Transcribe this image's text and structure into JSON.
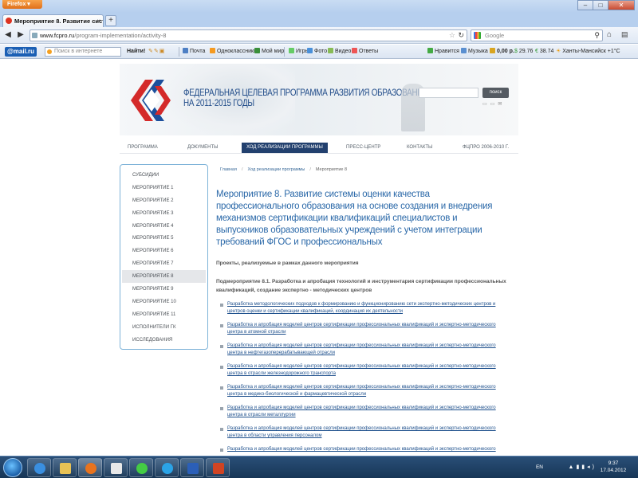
{
  "browser": {
    "app_button": "Firefox",
    "tab_title": "Мероприятие 8. Развитие системы оц...",
    "url_host": "www.fcpro.ru",
    "url_path": "/program-implementation/activity-8",
    "search_placeholder": "Google"
  },
  "mailru_toolbar": {
    "logo": "@mail.ru",
    "search_placeholder": "Поиск в интернете",
    "find_button": "Найти!",
    "items": [
      "Почта",
      "Одноклассники",
      "Мой мир",
      "Игры",
      "Фото",
      "Видео",
      "Ответы"
    ],
    "right_items": [
      "Нравится",
      "Музыка",
      "0,00 р.",
      "29.76",
      "38.74",
      "Ханты-Мансийск +1°C"
    ]
  },
  "site": {
    "header_title_line1": "ФЕДЕРАЛЬНАЯ ЦЕЛЕВАЯ ПРОГРАММА РАЗВИТИЯ ОБРАЗОВАНИЯ",
    "header_title_line2": "НА 2011-2015 ГОДЫ",
    "search_button": "поиск",
    "nav": [
      "ПРОГРАММА",
      "ДОКУМЕНТЫ",
      "ХОД РЕАЛИЗАЦИИ ПРОГРАММЫ",
      "ПРЕСС-ЦЕНТР",
      "КОНТАКТЫ",
      "ФЦПРО 2006-2010 Г."
    ],
    "sidebar": [
      "СУБСИДИИ",
      "МЕРОПРИЯТИЕ 1",
      "МЕРОПРИЯТИЕ 2",
      "МЕРОПРИЯТИЕ 3",
      "МЕРОПРИЯТИЕ 4",
      "МЕРОПРИЯТИЕ 5",
      "МЕРОПРИЯТИЕ 6",
      "МЕРОПРИЯТИЕ 7",
      "МЕРОПРИЯТИЕ 8",
      "МЕРОПРИЯТИЕ 9",
      "МЕРОПРИЯТИЕ 10",
      "МЕРОПРИЯТИЕ 11",
      "ИСПОЛНИТЕЛИ ГК",
      "ИССЛЕДОВАНИЯ"
    ],
    "breadcrumbs": [
      "Главная",
      "Ход реализации программы",
      "Мероприятие 8"
    ],
    "page_title": "Мероприятие 8. Развитие системы оценки качества профессионального образования на основе создания и внедрения механизмов сертификации квалификаций специалистов и выпускников образовательных учреждений с учетом интеграции требований ФГОС и профессиональных",
    "projects_heading": "Проекты, реализуемые в рамках данного мероприятия",
    "sub_heading": "Подмероприятие 8.1. Разработка и апробация технологий и инструментария сертификации профессиональных квалификаций, создание экспертно - методических центров",
    "links": [
      "Разработка методологических подходов к формированию и функционированию сети экспертно-методических центров и центров оценки и сертификации квалификаций, координация их деятельности",
      "Разработка и апробация моделей центров сертификации профессиональных квалификаций и экспертно-методического центра в атомной отрасли",
      "Разработка и апробация моделей центров сертификации профессиональных квалификаций и экспертно-методического центра в нефтегазоперерабатывающей отрасли",
      "Разработка и апробация моделей центров сертификации профессиональных квалификаций и экспертно-методического центра в отрасли железнодорожного транспорта",
      "Разработка и апробация моделей центров сертификации профессиональных квалификаций и экспертно-методического центра в медико-биологической и фармацевтической отрасли",
      "Разработка и апробация моделей центров сертификации профессиональных квалификаций и экспертно-методического центра в отрасли металлургии",
      "Разработка и апробация моделей центров сертификации профессиональных квалификаций и экспертно-методического центра в области управления персоналом",
      "Разработка и апробация моделей центров сертификации профессиональных квалификаций и экспертно-методического"
    ]
  },
  "taskbar": {
    "lang": "EN",
    "time": "9:37",
    "date": "17.04.2012"
  },
  "colors": {
    "site_blue": "#2a68a8",
    "nav_active": "#22406e",
    "sidebar_border": "#7eb3d8",
    "logo_red": "#d42a2a",
    "logo_blue": "#1c4f9c"
  }
}
